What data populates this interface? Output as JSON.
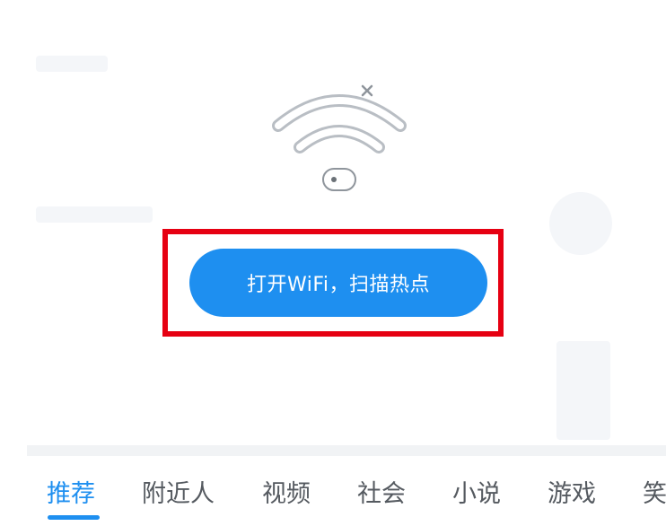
{
  "wifi_prompt": {
    "scan_button_label": "打开WiFi，扫描热点"
  },
  "tabs": [
    {
      "label": "推荐",
      "active": true
    },
    {
      "label": "附近人",
      "active": false
    },
    {
      "label": "视频",
      "active": false
    },
    {
      "label": "社会",
      "active": false
    },
    {
      "label": "小说",
      "active": false
    },
    {
      "label": "游戏",
      "active": false
    },
    {
      "label": "笑",
      "active": false
    }
  ],
  "colors": {
    "accent": "#1e8ff0",
    "highlight": "#e60012",
    "tab_text": "#555a60"
  },
  "icons": {
    "illustration": "wifi-disconnected-icon"
  }
}
